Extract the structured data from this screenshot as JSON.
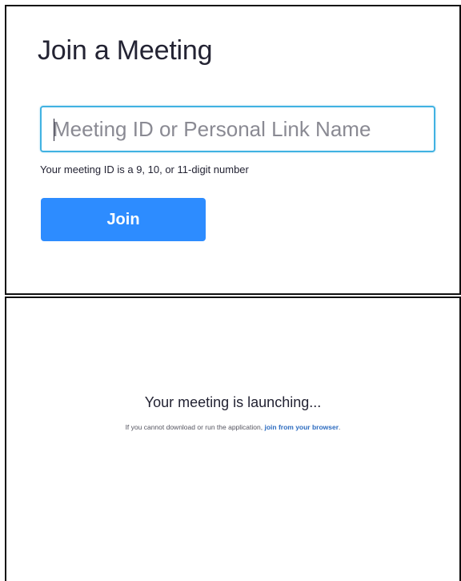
{
  "join_panel": {
    "title": "Join a Meeting",
    "input_placeholder": "Meeting ID or Personal Link Name",
    "input_value": "",
    "hint": "Your meeting ID is a 9, 10, or 11-digit number",
    "join_label": "Join",
    "accent_color": "#2d8cff",
    "input_border_color": "#41b2e2"
  },
  "launch_panel": {
    "title": "Your meeting is launching...",
    "sub_text": "If you cannot download or run the application, ",
    "link_label": "join from your browser",
    "trailing": "."
  }
}
